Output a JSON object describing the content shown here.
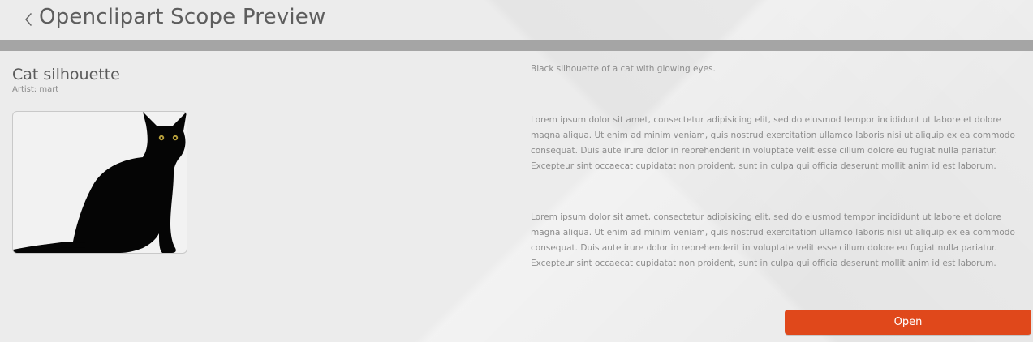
{
  "header": {
    "back_icon": "chevron-left-icon",
    "title": "Openclipart Scope Preview"
  },
  "item": {
    "title": "Cat silhouette",
    "artist": "Artist: mart",
    "image_icon": "cat-silhouette-image"
  },
  "description": {
    "summary": "Black silhouette of a cat with glowing eyes.",
    "paragraph1": "Lorem ipsum dolor sit amet, consectetur adipisicing elit, sed do eiusmod tempor incididunt ut labore et dolore magna aliqua. Ut enim ad minim veniam, quis nostrud exercitation ullamco laboris nisi ut aliquip ex ea commodo consequat. Duis aute irure dolor in reprehenderit in voluptate velit esse cillum dolore eu fugiat nulla pariatur. Excepteur sint occaecat cupidatat non proident, sunt in culpa qui officia deserunt mollit anim id est laborum.",
    "paragraph2": "Lorem ipsum dolor sit amet, consectetur adipisicing elit, sed do eiusmod tempor incididunt ut labore et dolore magna aliqua. Ut enim ad minim veniam, quis nostrud exercitation ullamco laboris nisi ut aliquip ex ea commodo consequat. Duis aute irure dolor in reprehenderit in voluptate velit esse cillum dolore eu fugiat nulla pariatur. Excepteur sint occaecat cupidatat non proident, sunt in culpa qui officia deserunt mollit anim id est laborum."
  },
  "actions": {
    "open_label": "Open"
  },
  "colors": {
    "accent": "#e0481b",
    "divider": "#a5a5a5",
    "background": "#ececec"
  }
}
